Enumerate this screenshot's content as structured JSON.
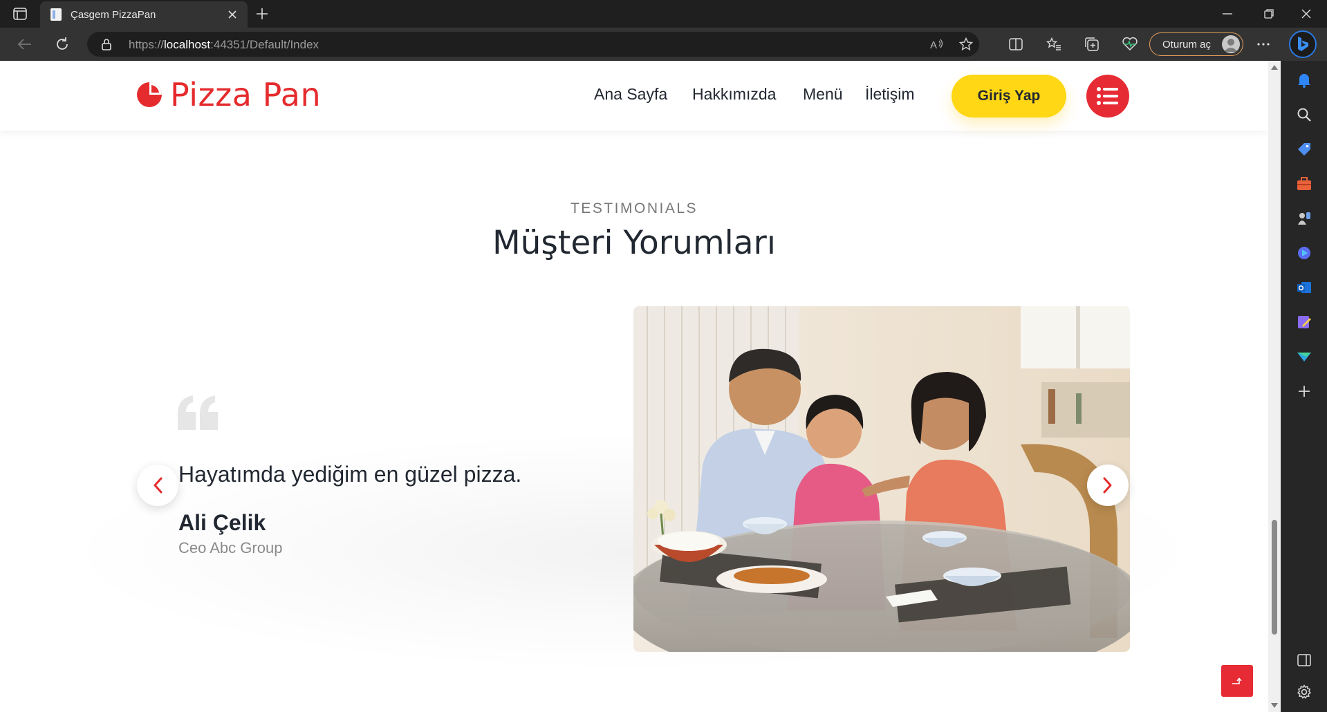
{
  "browser": {
    "tab_title": "Çasgem PizzaPan",
    "url_prefix": "https://",
    "url_host": "localhost",
    "url_rest": ":44351/Default/Index",
    "signin_label": "Oturum aç"
  },
  "site": {
    "logo_text": "Pizza Pan",
    "nav": [
      "Ana Sayfa",
      "Hakkımızda",
      "Menü",
      "İletişim"
    ],
    "login_label": "Giriş Yap"
  },
  "section": {
    "eyebrow": "TESTIMONIALS",
    "heading": "Müşteri Yorumları"
  },
  "review": {
    "text": "Hayatımda yediğim en güzel pizza.",
    "name": "Ali Çelik",
    "role": "Ceo Abc Group"
  },
  "colors": {
    "brand_red": "#e52b2d",
    "button_yellow": "#ffd714",
    "text_dark": "#222831"
  },
  "icons": {
    "prev": "chevron-left-icon",
    "next": "chevron-right-icon",
    "menu": "list-icon",
    "quote": "quote-icon"
  }
}
